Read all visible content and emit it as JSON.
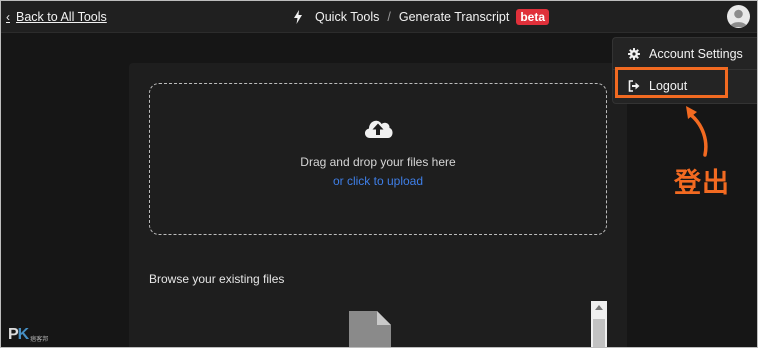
{
  "topbar": {
    "back_label": "Back to All Tools",
    "crumb_1": "Quick Tools",
    "crumb_sep": "/",
    "crumb_2": "Generate Transcript",
    "badge": "beta"
  },
  "upload": {
    "drop_text": "Drag and drop your files here",
    "link_text": "or click to upload"
  },
  "files": {
    "browse_label": "Browse your existing files"
  },
  "menu": {
    "items": [
      {
        "label": "Account Settings",
        "icon": "gear-icon"
      },
      {
        "label": "Logout",
        "icon": "logout-icon"
      }
    ]
  },
  "annotation": {
    "text": "登出"
  },
  "watermark": {
    "brand_p": "P",
    "brand_k": "K",
    "tagline": "痞客邦"
  },
  "colors": {
    "background": "#161616",
    "panel": "#1e1e1e",
    "link": "#3f7fe8",
    "badge": "#e0303a",
    "annotation": "#f26a21"
  }
}
